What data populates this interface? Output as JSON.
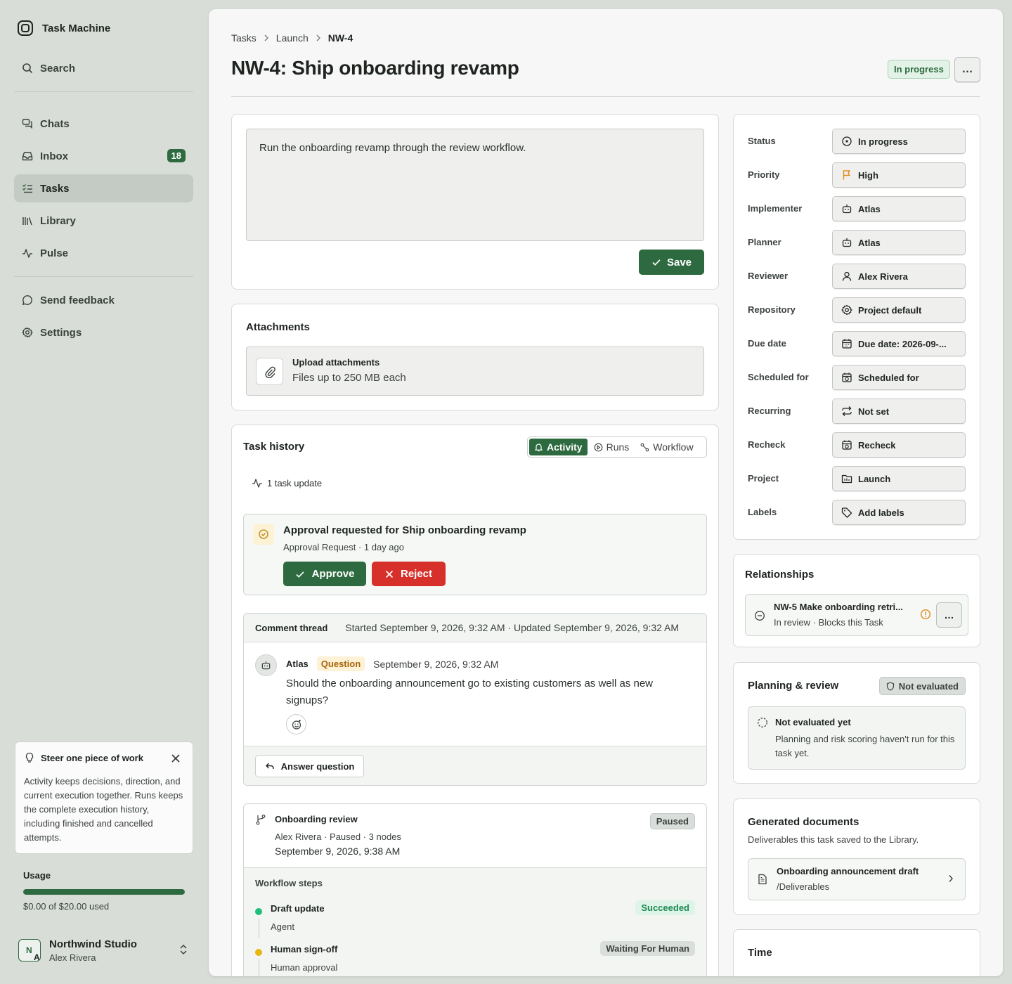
{
  "app": {
    "name": "Task Machine"
  },
  "sidebar": {
    "search_label": "Search",
    "items": [
      {
        "label": "Chats",
        "icon": "chats-icon"
      },
      {
        "label": "Inbox",
        "icon": "inbox-icon",
        "badge": "18"
      },
      {
        "label": "Tasks",
        "icon": "tasks-icon",
        "active": true
      },
      {
        "label": "Library",
        "icon": "library-icon"
      },
      {
        "label": "Pulse",
        "icon": "pulse-icon"
      }
    ],
    "feedback_label": "Send feedback",
    "settings_label": "Settings",
    "tip": {
      "title": "Steer one piece of work",
      "body": "Activity keeps decisions, direction, and current execution together. Runs keeps the complete execution history, including finished and cancelled attempts."
    },
    "usage": {
      "title": "Usage",
      "text": "$0.00 of $20.00 used",
      "fraction": 1.0
    },
    "workspace": {
      "initials_top": "N",
      "initials_bottom": "A",
      "name": "Northwind Studio",
      "user": "Alex Rivera"
    }
  },
  "breadcrumb": [
    "Tasks",
    "Launch",
    "NW-4"
  ],
  "task": {
    "title": "NW-4: Ship onboarding revamp",
    "status_badge": "In progress",
    "more_label": "…",
    "description": "Run the onboarding revamp through the review workflow.",
    "save_label": "Save"
  },
  "attachments": {
    "title": "Attachments",
    "upload_title": "Upload attachments",
    "upload_sub": "Files up to 250 MB each"
  },
  "history": {
    "title": "Task history",
    "tabs": [
      {
        "label": "Activity",
        "icon": "bell-icon",
        "active": true
      },
      {
        "label": "Runs",
        "icon": "runs-icon"
      },
      {
        "label": "Workflow",
        "icon": "workflow-icon"
      }
    ],
    "update_count": "1 task update",
    "approval": {
      "title": "Approval requested for Ship onboarding revamp",
      "sub": "Approval Request · 1 day ago",
      "approve_label": "Approve",
      "reject_label": "Reject"
    },
    "thread": {
      "title": "Comment thread",
      "meta": "Started September 9, 2026, 9:32 AM · Updated September 9, 2026, 9:32 AM",
      "comment": {
        "author": "Atlas",
        "badge": "Question",
        "time": "September 9, 2026, 9:32 AM",
        "body": "Should the onboarding announcement go to existing customers as well as new signups?"
      },
      "answer_label": "Answer question"
    },
    "workflow": {
      "title": "Onboarding review",
      "sub": "Alex Rivera · Paused · 3 nodes",
      "date": "September 9, 2026, 9:38 AM",
      "badge": "Paused",
      "steps_title": "Workflow steps",
      "steps": [
        {
          "name": "Draft update",
          "type": "Agent",
          "status": "Succeeded",
          "dot": "#1fbf7a",
          "badge_bg": "#dff4e8",
          "badge_fg": "#1e8a55"
        },
        {
          "name": "Human sign-off",
          "type": "Human approval",
          "status": "Waiting For Human",
          "dot": "#e8b60f",
          "badge_bg": "#dadedb",
          "badge_fg": "#3c423e"
        }
      ]
    }
  },
  "properties": [
    {
      "label": "Status",
      "value": "In progress",
      "icon": "status-circle-icon"
    },
    {
      "label": "Priority",
      "value": "High",
      "icon": "flag-icon"
    },
    {
      "label": "Implementer",
      "value": "Atlas",
      "icon": "bot-icon"
    },
    {
      "label": "Planner",
      "value": "Atlas",
      "icon": "bot-icon"
    },
    {
      "label": "Reviewer",
      "value": "Alex Rivera",
      "icon": "user-icon"
    },
    {
      "label": "Repository",
      "value": "Project default",
      "icon": "gear-icon"
    },
    {
      "label": "Due date",
      "value": "Due date: 2026-09-...",
      "icon": "calendar-icon"
    },
    {
      "label": "Scheduled for",
      "value": "Scheduled for",
      "icon": "calendar-clock-icon"
    },
    {
      "label": "Recurring",
      "value": "Not set",
      "icon": "repeat-icon"
    },
    {
      "label": "Recheck",
      "value": "Recheck",
      "icon": "calendar-clock-icon"
    },
    {
      "label": "Project",
      "value": "Launch",
      "icon": "folder-icon"
    },
    {
      "label": "Labels",
      "value": "Add labels",
      "icon": "tag-icon"
    }
  ],
  "relationships": {
    "title": "Relationships",
    "item": {
      "title": "NW-5 Make onboarding retri...",
      "sub": "In review · Blocks this Task",
      "more_label": "…"
    }
  },
  "planning": {
    "title": "Planning & review",
    "badge": "Not evaluated",
    "box_title": "Not evaluated yet",
    "box_body": "Planning and risk scoring haven't run for this task yet."
  },
  "generated_docs": {
    "title": "Generated documents",
    "sub": "Deliverables this task saved to the Library.",
    "item": {
      "title": "Onboarding announcement draft",
      "path": "/Deliverables"
    }
  },
  "time": {
    "title": "Time"
  },
  "colors": {
    "accent": "#2d6a3f",
    "danger": "#d7302a",
    "warning": "#e8b60f"
  }
}
